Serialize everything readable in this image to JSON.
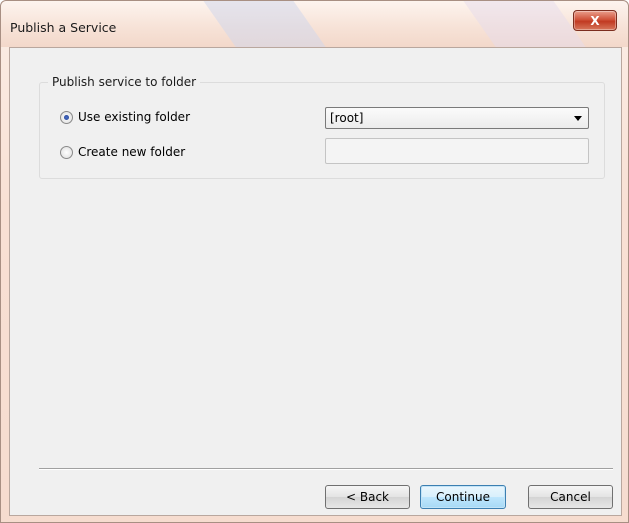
{
  "window": {
    "title": "Publish a Service",
    "close_label": "X"
  },
  "group": {
    "label": "Publish service to folder",
    "options": [
      {
        "label": "Use existing folder",
        "checked": true
      },
      {
        "label": "Create new folder",
        "checked": false
      }
    ],
    "folder_select": {
      "selected": "[root]"
    },
    "new_folder_input": {
      "value": ""
    }
  },
  "buttons": {
    "back": "< Back",
    "continue": "Continue",
    "cancel": "Cancel"
  },
  "colors": {
    "titlebar_tint": "#f7e3d8",
    "close_red": "#c13a22",
    "default_button_border": "#3c7fb1",
    "client_bg": "#f0f0f0"
  }
}
